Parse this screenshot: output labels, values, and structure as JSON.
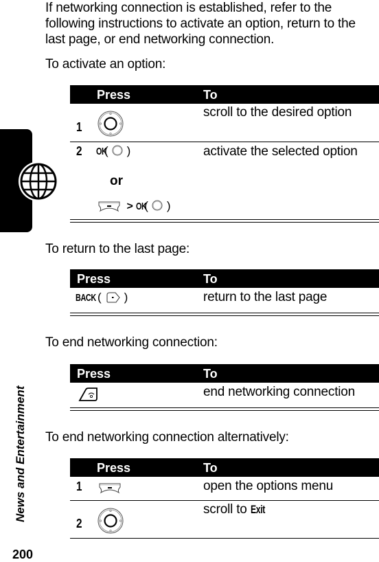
{
  "intro": {
    "line1": "If networking connection is established, refer to the",
    "line2": "following instructions to activate an option, return to the",
    "line3": "last page, or end networking connection."
  },
  "sections": [
    {
      "heading": "To activate an option:",
      "columns": [
        "Press",
        "To"
      ],
      "rows": [
        {
          "num": "1",
          "press_icon": "nav-key-icon",
          "action": "scroll to the desired option"
        },
        {
          "num": "2",
          "press_key": "OK",
          "press_icon": "center-select-key-icon",
          "or_label": "or",
          "alt_press_icon": "menu-key-icon",
          "alt_separator": ">",
          "alt_key": "OK",
          "alt_icon": "center-select-key-icon",
          "action": "activate the selected option"
        }
      ]
    },
    {
      "heading": "To return to the last page:",
      "columns": [
        "Press",
        "To"
      ],
      "rows": [
        {
          "press_key": "BACK",
          "press_icon": "back-soft-key-icon",
          "action": "return to the last page"
        }
      ]
    },
    {
      "heading": "To end networking connection:",
      "columns": [
        "Press",
        "To"
      ],
      "rows": [
        {
          "press_icon": "end-key-icon",
          "action": "end networking connection"
        }
      ]
    },
    {
      "heading": "To end networking connection alternatively:",
      "columns": [
        "Press",
        "To"
      ],
      "rows": [
        {
          "num": "1",
          "press_icon": "menu-key-icon",
          "action": "open the options menu"
        },
        {
          "num": "2",
          "press_icon": "nav-key-icon",
          "action_prefix": "scroll to ",
          "action_bold": "Exit"
        }
      ]
    }
  ],
  "sidebar": {
    "section_label": "News and Entertainment",
    "section_icon": "globe-icon"
  },
  "page_number": "200"
}
